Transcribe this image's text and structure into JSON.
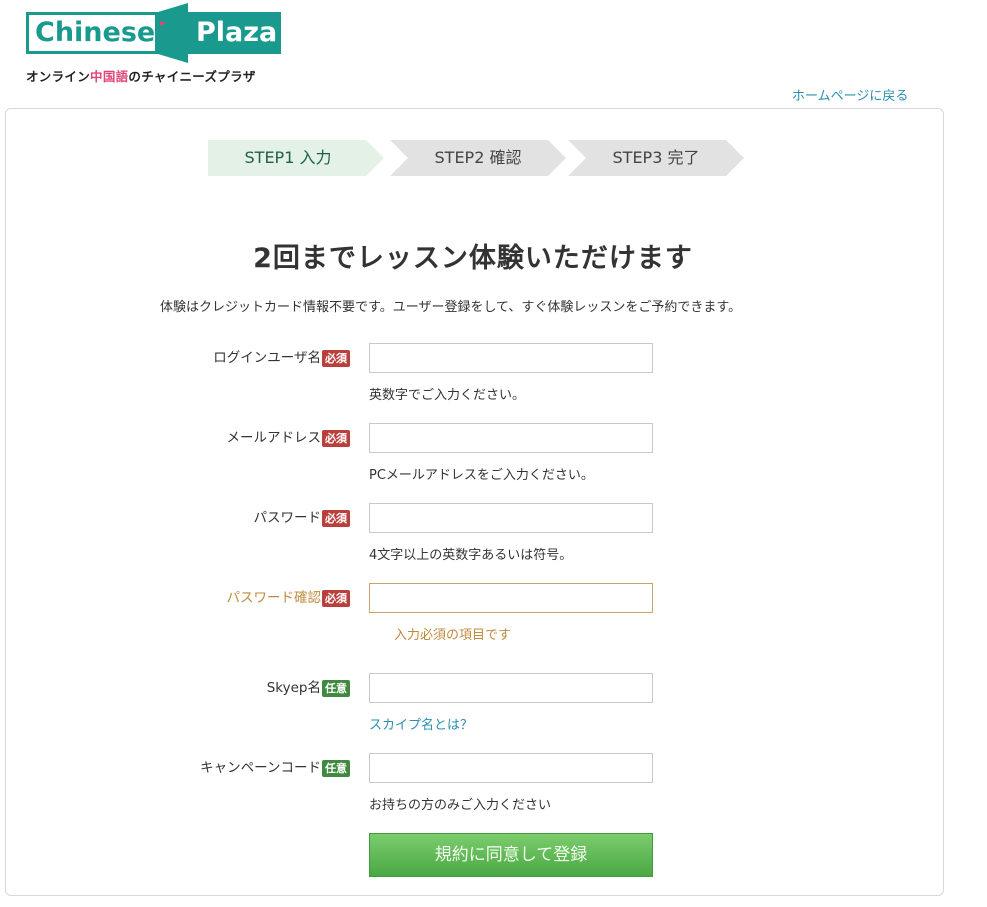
{
  "brand": {
    "logo_left": "Chinese",
    "logo_right": "Plaza",
    "tagline_pre": "オンライン",
    "tagline_hl": "中国語",
    "tagline_post": "のチャイニーズプラザ",
    "colors": {
      "teal": "#1a9a8f",
      "pink": "#e0457a"
    }
  },
  "nav": {
    "home_link": "ホームページに戻る"
  },
  "steps": [
    {
      "label": "STEP1 入力",
      "active": true
    },
    {
      "label": "STEP2 確認",
      "active": false
    },
    {
      "label": "STEP3 完了",
      "active": false
    }
  ],
  "heading": "2回までレッスン体験いただけます",
  "subtext": "体験はクレジットカード情報不要です。ユーザー登録をして、すぐ体験レッスンをご予約できます。",
  "form": {
    "username": {
      "label": "ログインユーザ名",
      "badge": "必須",
      "value": "",
      "hint": "英数字でご入力ください。"
    },
    "email": {
      "label": "メールアドレス",
      "badge": "必須",
      "value": "",
      "hint": "PCメールアドレスをご入力ください。"
    },
    "password": {
      "label": "パスワード",
      "badge": "必須",
      "value": "",
      "hint": "4文字以上の英数字あるいは符号。"
    },
    "password_confirm": {
      "label": "パスワード確認",
      "badge": "必須",
      "value": "",
      "error": "入力必須の項目です"
    },
    "skype": {
      "label": "Skyep名",
      "badge": "任意",
      "value": "",
      "hint": "スカイプ名とは？"
    },
    "campaign": {
      "label": "キャンペーンコード",
      "badge": "任意",
      "value": "",
      "hint": "お持ちの方のみご入力ください"
    },
    "submit_label": "規約に同意して登録"
  },
  "colors": {
    "required_badge": "#b8403d",
    "optional_badge": "#3f8a3f",
    "error_text": "#c08a3e",
    "link": "#2a8fb0",
    "submit_green": "#5cb550"
  }
}
